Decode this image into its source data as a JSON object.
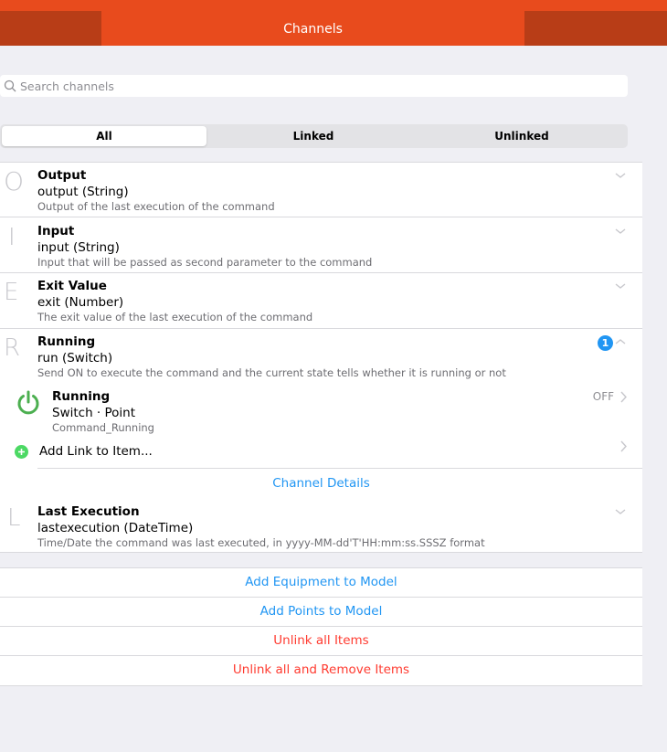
{
  "header": {
    "title": "Channels"
  },
  "search": {
    "placeholder": "Search channels"
  },
  "tabs": [
    "All",
    "Linked",
    "Unlinked"
  ],
  "channels": [
    {
      "letter": "O",
      "label": "Output",
      "id": "output (String)",
      "description": "Output of the last execution of the command"
    },
    {
      "letter": "I",
      "label": "Input",
      "id": "input (String)",
      "description": "Input that will be passed as second parameter to the command"
    },
    {
      "letter": "E",
      "label": "Exit Value",
      "id": "exit (Number)",
      "description": "The exit value of the last execution of the command"
    },
    {
      "letter": "R",
      "label": "Running",
      "id": "run (Switch)",
      "description": "Send ON to execute the command and the current state tells whether it is running or not",
      "badge": "1"
    },
    {
      "letter": "L",
      "label": "Last Execution",
      "id": "lastexecution (DateTime)",
      "description": "Time/Date the command was last executed, in yyyy-MM-dd'T'HH:mm:ss.SSSZ format"
    }
  ],
  "linked_item": {
    "label": "Running",
    "type": "Switch · Point",
    "name": "Command_Running",
    "state": "OFF"
  },
  "add_link": "Add Link to Item...",
  "channel_details": "Channel Details",
  "actions": {
    "add_equipment": "Add Equipment to Model",
    "add_points": "Add Points to Model",
    "unlink_all": "Unlink all Items",
    "unlink_remove": "Unlink all and Remove Items"
  },
  "colors": {
    "accent": "#e84b1d",
    "link": "#2196f3",
    "danger": "#ff3b30",
    "power": "#4caf50"
  }
}
